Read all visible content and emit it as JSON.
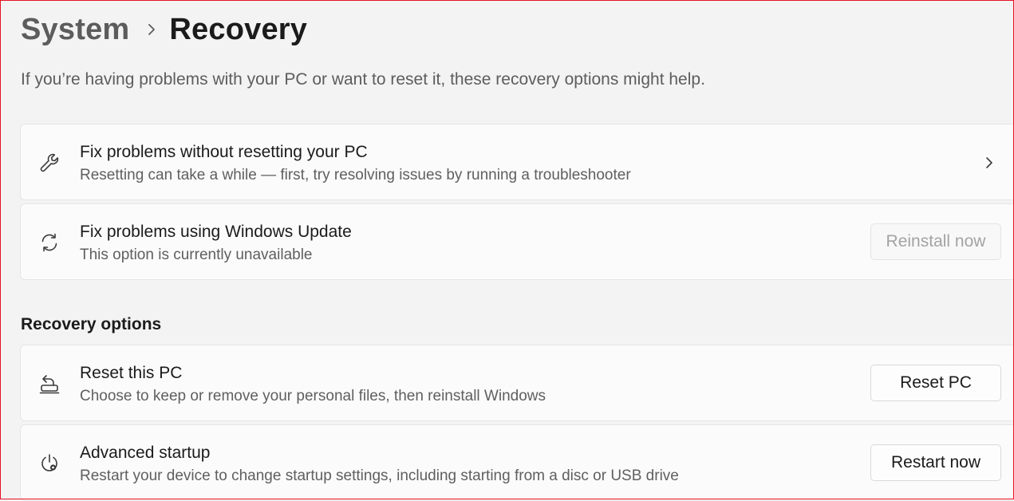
{
  "breadcrumb": {
    "parent": "System",
    "separator_icon": "chevron-right-icon",
    "current": "Recovery"
  },
  "intro": "If you’re having problems with your PC or want to reset it, these recovery options might help.",
  "cards_top": [
    {
      "icon": "wrench-icon",
      "title": "Fix problems without resetting your PC",
      "description": "Resetting can take a while — first, try resolving issues by running a troubleshooter",
      "action_icon": "chevron-right-icon"
    },
    {
      "icon": "sync-icon",
      "title": "Fix problems using Windows Update",
      "description": "This option is currently unavailable",
      "button_label": "Reinstall now",
      "button_state": "disabled"
    }
  ],
  "recovery_options": {
    "heading": "Recovery options",
    "items": [
      {
        "icon": "reset-pc-icon",
        "title": "Reset this PC",
        "description": "Choose to keep or remove your personal files, then reinstall Windows",
        "button_label": "Reset PC"
      },
      {
        "icon": "advanced-startup-icon",
        "title": "Advanced startup",
        "description": "Restart your device to change startup settings, including starting from a disc or USB drive",
        "button_label": "Restart now"
      }
    ]
  },
  "colors": {
    "background": "#f3f3f3",
    "card": "#fbfbfb",
    "card_border": "#e5e5e5",
    "secondary_text": "#5f5f5f",
    "disabled_text": "#a3a3a3",
    "frame_border": "#e81123"
  }
}
